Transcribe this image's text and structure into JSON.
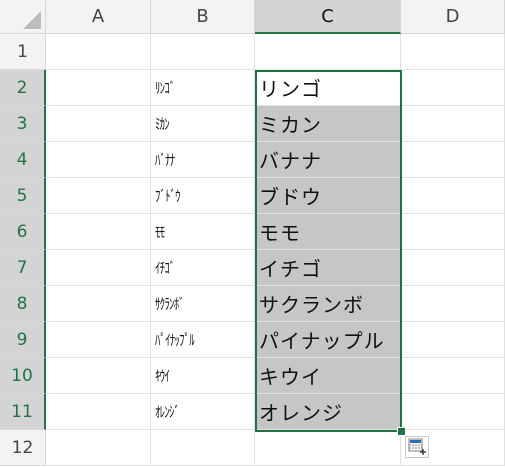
{
  "columns": [
    "A",
    "B",
    "C",
    "D"
  ],
  "rows": [
    "1",
    "2",
    "3",
    "4",
    "5",
    "6",
    "7",
    "8",
    "9",
    "10",
    "11",
    "12"
  ],
  "selection": {
    "column": "C",
    "rows": [
      "2",
      "11"
    ]
  },
  "column_b": [
    "",
    "ﾘﾝｺﾞ",
    "ﾐｶﾝ",
    "ﾊﾞﾅﾅ",
    "ﾌﾞﾄﾞｳ",
    "ﾓﾓ",
    "ｲﾁｺﾞ",
    "ｻｸﾗﾝﾎﾞ",
    "ﾊﾟｲﾅｯﾌﾟﾙ",
    "ｷｳｲ",
    "ｵﾚﾝｼﾞ",
    ""
  ],
  "column_c": [
    "",
    "リンゴ",
    "ミカン",
    "バナナ",
    "ブドウ",
    "モモ",
    "イチゴ",
    "サクランボ",
    "パイナップル",
    "キウイ",
    "オレンジ",
    ""
  ],
  "colors": {
    "selection_border": "#217346",
    "selected_fill": "#c6c6c6",
    "header_bg": "#f3f3f3"
  },
  "icons": {
    "corner": "select-all-triangle-icon",
    "quick_analysis": "quick-analysis-icon"
  }
}
